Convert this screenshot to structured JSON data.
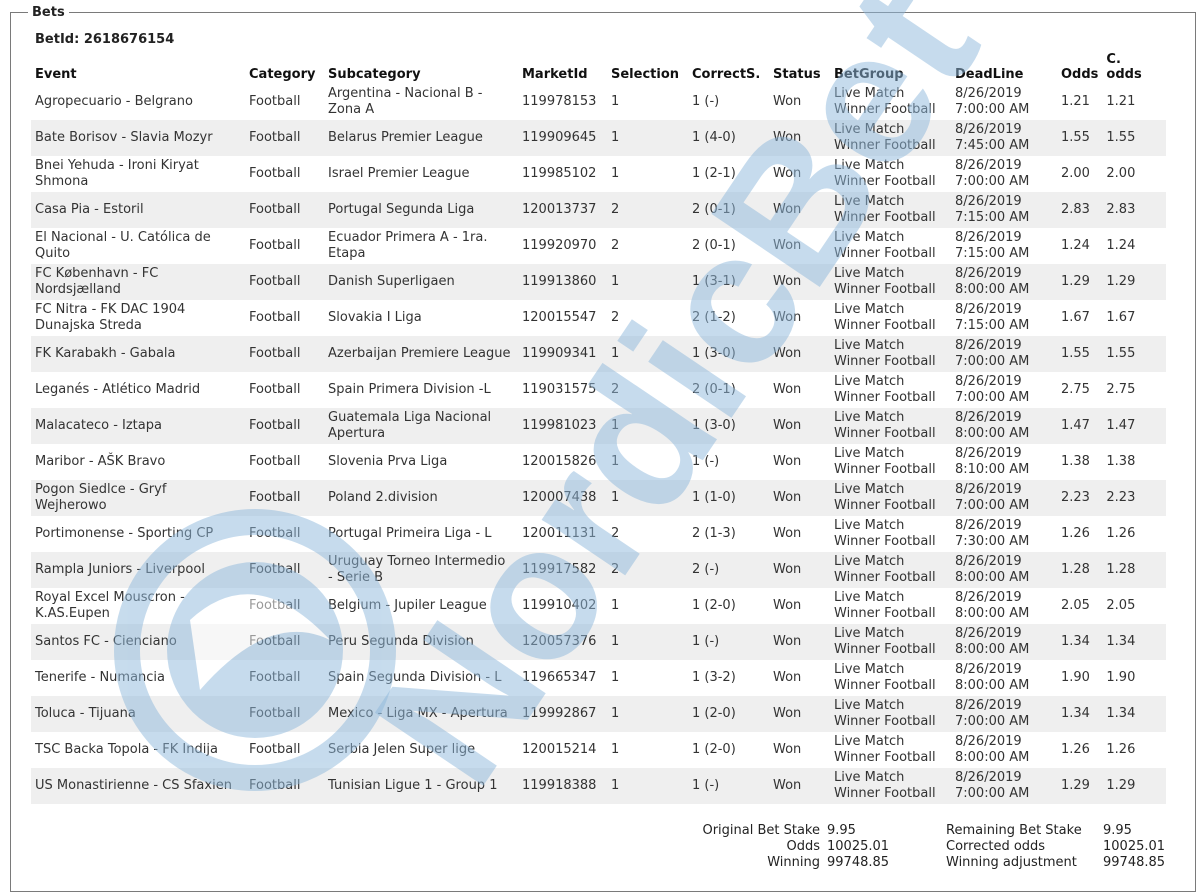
{
  "legend": "Bets",
  "bet": {
    "id_label": "BetId:",
    "id_value": "2618676154"
  },
  "columns": {
    "event": "Event",
    "category": "Category",
    "subcategory": "Subcategory",
    "market_id": "MarketId",
    "selection": "Selection",
    "correct_s": "CorrectS.",
    "status": "Status",
    "bet_group": "BetGroup",
    "deadline": "DeadLine",
    "odds": "Odds",
    "c_odds": "C. odds"
  },
  "rows": [
    {
      "event": "Agropecuario - Belgrano",
      "category": "Football",
      "subcategory": "Argentina - Nacional B - Zona A",
      "market_id": "119978153",
      "selection": "1",
      "correct_s": "1 (-)",
      "status": "Won",
      "bet_group": "Live Match Winner Football",
      "deadline": "8/26/2019 7:00:00 AM",
      "odds": "1.21",
      "c_odds": "1.21"
    },
    {
      "event": "Bate Borisov - Slavia Mozyr",
      "category": "Football",
      "subcategory": "Belarus Premier League",
      "market_id": "119909645",
      "selection": "1",
      "correct_s": "1 (4-0)",
      "status": "Won",
      "bet_group": "Live Match Winner Football",
      "deadline": "8/26/2019 7:45:00 AM",
      "odds": "1.55",
      "c_odds": "1.55"
    },
    {
      "event": "Bnei Yehuda - Ironi Kiryat Shmona",
      "category": "Football",
      "subcategory": "Israel Premier League",
      "market_id": "119985102",
      "selection": "1",
      "correct_s": "1 (2-1)",
      "status": "Won",
      "bet_group": "Live Match Winner Football",
      "deadline": "8/26/2019 7:00:00 AM",
      "odds": "2.00",
      "c_odds": "2.00"
    },
    {
      "event": "Casa Pia - Estoril",
      "category": "Football",
      "subcategory": "Portugal Segunda Liga",
      "market_id": "120013737",
      "selection": "2",
      "correct_s": "2 (0-1)",
      "status": "Won",
      "bet_group": "Live Match Winner Football",
      "deadline": "8/26/2019 7:15:00 AM",
      "odds": "2.83",
      "c_odds": "2.83"
    },
    {
      "event": "El Nacional - U. Católica de Quito",
      "category": "Football",
      "subcategory": "Ecuador Primera A - 1ra. Etapa",
      "market_id": "119920970",
      "selection": "2",
      "correct_s": "2 (0-1)",
      "status": "Won",
      "bet_group": "Live Match Winner Football",
      "deadline": "8/26/2019 7:15:00 AM",
      "odds": "1.24",
      "c_odds": "1.24"
    },
    {
      "event": "FC København - FC Nordsjælland",
      "category": "Football",
      "subcategory": "Danish Superligaen",
      "market_id": "119913860",
      "selection": "1",
      "correct_s": "1 (3-1)",
      "status": "Won",
      "bet_group": "Live Match Winner Football",
      "deadline": "8/26/2019 8:00:00 AM",
      "odds": "1.29",
      "c_odds": "1.29"
    },
    {
      "event": "FC Nitra - FK DAC 1904 Dunajska Streda",
      "category": "Football",
      "subcategory": "Slovakia I Liga",
      "market_id": "120015547",
      "selection": "2",
      "correct_s": "2 (1-2)",
      "status": "Won",
      "bet_group": "Live Match Winner Football",
      "deadline": "8/26/2019 7:15:00 AM",
      "odds": "1.67",
      "c_odds": "1.67"
    },
    {
      "event": "FK Karabakh - Gabala",
      "category": "Football",
      "subcategory": "Azerbaijan Premiere League",
      "market_id": "119909341",
      "selection": "1",
      "correct_s": "1 (3-0)",
      "status": "Won",
      "bet_group": "Live Match Winner Football",
      "deadline": "8/26/2019 7:00:00 AM",
      "odds": "1.55",
      "c_odds": "1.55"
    },
    {
      "event": "Leganés - Atlético Madrid",
      "category": "Football",
      "subcategory": "Spain Primera Division -L",
      "market_id": "119031575",
      "selection": "2",
      "correct_s": "2 (0-1)",
      "status": "Won",
      "bet_group": "Live Match Winner Football",
      "deadline": "8/26/2019 7:00:00 AM",
      "odds": "2.75",
      "c_odds": "2.75"
    },
    {
      "event": "Malacateco - Iztapa",
      "category": "Football",
      "subcategory": "Guatemala Liga Nacional Apertura",
      "market_id": "119981023",
      "selection": "1",
      "correct_s": "1 (3-0)",
      "status": "Won",
      "bet_group": "Live Match Winner Football",
      "deadline": "8/26/2019 8:00:00 AM",
      "odds": "1.47",
      "c_odds": "1.47"
    },
    {
      "event": "Maribor - AŠK Bravo",
      "category": "Football",
      "subcategory": "Slovenia Prva Liga",
      "market_id": "120015826",
      "selection": "1",
      "correct_s": "1 (-)",
      "status": "Won",
      "bet_group": "Live Match Winner Football",
      "deadline": "8/26/2019 8:10:00 AM",
      "odds": "1.38",
      "c_odds": "1.38"
    },
    {
      "event": "Pogon Siedlce - Gryf Wejherowo",
      "category": "Football",
      "subcategory": "Poland 2.division",
      "market_id": "120007438",
      "selection": "1",
      "correct_s": "1 (1-0)",
      "status": "Won",
      "bet_group": "Live Match Winner Football",
      "deadline": "8/26/2019 7:00:00 AM",
      "odds": "2.23",
      "c_odds": "2.23"
    },
    {
      "event": "Portimonense - Sporting CP",
      "category": "Football",
      "subcategory": "Portugal Primeira Liga - L",
      "market_id": "120011131",
      "selection": "2",
      "correct_s": "2 (1-3)",
      "status": "Won",
      "bet_group": "Live Match Winner Football",
      "deadline": "8/26/2019 7:30:00 AM",
      "odds": "1.26",
      "c_odds": "1.26"
    },
    {
      "event": "Rampla Juniors - Liverpool",
      "category": "Football",
      "subcategory": "Uruguay Torneo Intermedio - Serie B",
      "market_id": "119917582",
      "selection": "2",
      "correct_s": "2 (-)",
      "status": "Won",
      "bet_group": "Live Match Winner Football",
      "deadline": "8/26/2019 8:00:00 AM",
      "odds": "1.28",
      "c_odds": "1.28"
    },
    {
      "event": "Royal Excel Mouscron - K.AS.Eupen",
      "category": "Football",
      "subcategory": "Belgium - Jupiler League",
      "market_id": "119910402",
      "selection": "1",
      "correct_s": "1 (2-0)",
      "status": "Won",
      "bet_group": "Live Match Winner Football",
      "deadline": "8/26/2019 8:00:00 AM",
      "odds": "2.05",
      "c_odds": "2.05"
    },
    {
      "event": "Santos FC - Cienciano",
      "category": "Football",
      "subcategory": "Peru Segunda Division",
      "market_id": "120057376",
      "selection": "1",
      "correct_s": "1 (-)",
      "status": "Won",
      "bet_group": "Live Match Winner Football",
      "deadline": "8/26/2019 8:00:00 AM",
      "odds": "1.34",
      "c_odds": "1.34"
    },
    {
      "event": "Tenerife - Numancia",
      "category": "Football",
      "subcategory": "Spain Segunda Division - L",
      "market_id": "119665347",
      "selection": "1",
      "correct_s": "1 (3-2)",
      "status": "Won",
      "bet_group": "Live Match Winner Football",
      "deadline": "8/26/2019 8:00:00 AM",
      "odds": "1.90",
      "c_odds": "1.90"
    },
    {
      "event": "Toluca - Tijuana",
      "category": "Football",
      "subcategory": "Mexico - Liga MX - Apertura",
      "market_id": "119992867",
      "selection": "1",
      "correct_s": "1 (2-0)",
      "status": "Won",
      "bet_group": "Live Match Winner Football",
      "deadline": "8/26/2019 7:00:00 AM",
      "odds": "1.34",
      "c_odds": "1.34"
    },
    {
      "event": "TSC Backa Topola - FK Indija",
      "category": "Football",
      "subcategory": "Serbia Jelen Super lige",
      "market_id": "120015214",
      "selection": "1",
      "correct_s": "1 (2-0)",
      "status": "Won",
      "bet_group": "Live Match Winner Football",
      "deadline": "8/26/2019 8:00:00 AM",
      "odds": "1.26",
      "c_odds": "1.26"
    },
    {
      "event": "US Monastirienne - CS Sfaxien",
      "category": "Football",
      "subcategory": "Tunisian Ligue 1 - Group 1",
      "market_id": "119918388",
      "selection": "1",
      "correct_s": "1 (-)",
      "status": "Won",
      "bet_group": "Live Match Winner Football",
      "deadline": "8/26/2019 7:00:00 AM",
      "odds": "1.29",
      "c_odds": "1.29"
    }
  ],
  "summary": {
    "left": [
      {
        "label": "Original Bet Stake",
        "value": "9.95"
      },
      {
        "label": "Odds",
        "value": "10025.01"
      },
      {
        "label": "Winning",
        "value": "99748.85"
      }
    ],
    "right": [
      {
        "label": "Remaining Bet Stake",
        "value": "9.95"
      },
      {
        "label": "Corrected odds",
        "value": "10025.01"
      },
      {
        "label": "Winning adjustment",
        "value": "99748.85"
      }
    ]
  },
  "watermark": {
    "text": "NordicBet",
    "color": "#8fb9dc"
  }
}
